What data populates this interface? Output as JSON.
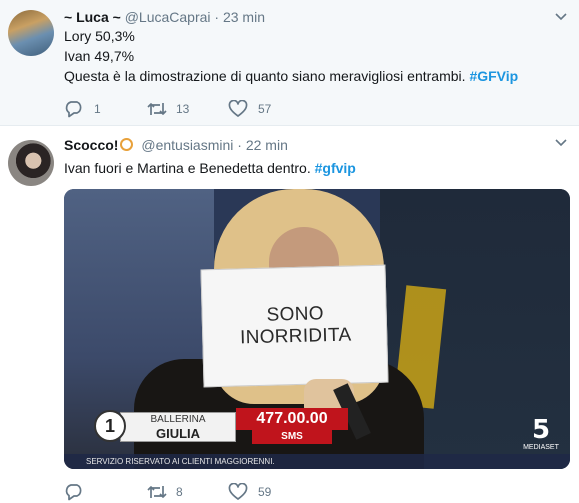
{
  "tweets": [
    {
      "name": "~ Luca ~",
      "handle": "@LucaCaprai",
      "dot": "·",
      "time": "23 min",
      "lines": [
        "Lory 50,3%",
        "Ivan 49,7%",
        "Questa è la dimostrazione di quanto siano meravigliosi entrambi."
      ],
      "hashtag": "#GFVip",
      "replies": "1",
      "retweets": "13",
      "likes": "57"
    },
    {
      "name": "Scocco!",
      "emoji_icon": "pretzel-emoji",
      "handle": "@entusiasmini",
      "dot": "·",
      "time": "22 min",
      "text": "Ivan fuori e Martina e Benedetta dentro.",
      "hashtag": "#gfvip",
      "media": {
        "sign_line1": "SONO",
        "sign_line2": "INORRIDITA",
        "contestant_number": "1",
        "contestant_role": "BALLERINA",
        "contestant_name": "GIULIA",
        "vote_count": "477.00.00",
        "vote_unit": "SMS",
        "disclaimer": "SERVIZIO RISERVATO AI CLIENTI MAGGIORENNI.",
        "channel_number": "5",
        "channel_name": "MEDIASET"
      },
      "replies": "",
      "retweets": "8",
      "likes": "59"
    }
  ],
  "colors": {
    "accent": "#1b95e0",
    "muted": "#657786",
    "vote_red": "#c0141c"
  }
}
